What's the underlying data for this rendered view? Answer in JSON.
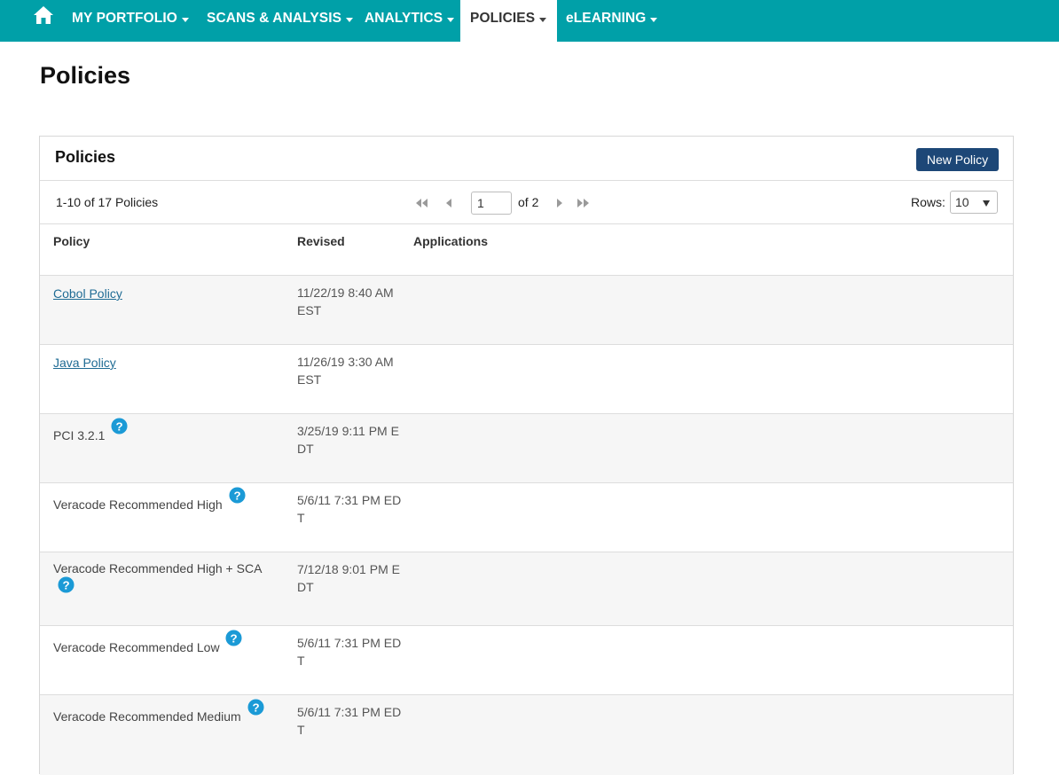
{
  "nav": {
    "items": [
      {
        "label": "MY PORTFOLIO"
      },
      {
        "label": "SCANS & ANALYSIS"
      },
      {
        "label": "ANALYTICS"
      },
      {
        "label": "POLICIES"
      },
      {
        "label": "eLEARNING"
      }
    ],
    "active": "POLICIES"
  },
  "page": {
    "title": "Policies"
  },
  "panel": {
    "title": "Policies",
    "new_button": "New Policy"
  },
  "pager": {
    "summary": "1-10 of 17 Policies",
    "page_value": "1",
    "of_label": "of 2",
    "rows_label": "Rows:",
    "rows_value": "10"
  },
  "table": {
    "columns": [
      "Policy",
      "Revised",
      "Applications"
    ],
    "rows": [
      {
        "policy": "Cobol Policy",
        "revised": "11/22/19 8:40 AM EST",
        "link": true,
        "help": false
      },
      {
        "policy": "Java Policy",
        "revised": "11/26/19 3:30 AM EST",
        "link": true,
        "help": false
      },
      {
        "policy": "PCI 3.2.1",
        "revised": "3/25/19 9:11 PM EDT",
        "link": false,
        "help": true
      },
      {
        "policy": "Veracode Recommended High",
        "revised": "5/6/11 7:31 PM EDT",
        "link": false,
        "help": true
      },
      {
        "policy": "Veracode Recommended High + SCA",
        "revised": "7/12/18 9:01 PM EDT",
        "link": false,
        "help": true
      },
      {
        "policy": "Veracode Recommended Low",
        "revised": "5/6/11 7:31 PM EDT",
        "link": false,
        "help": true
      },
      {
        "policy": "Veracode Recommended Medium",
        "revised": "5/6/11 7:31 PM EDT",
        "link": false,
        "help": true
      }
    ]
  },
  "colors": {
    "nav_bg": "#00a0a8",
    "button_bg": "#1d4777",
    "link": "#1f6b94",
    "help_icon": "#1b9ad6"
  }
}
